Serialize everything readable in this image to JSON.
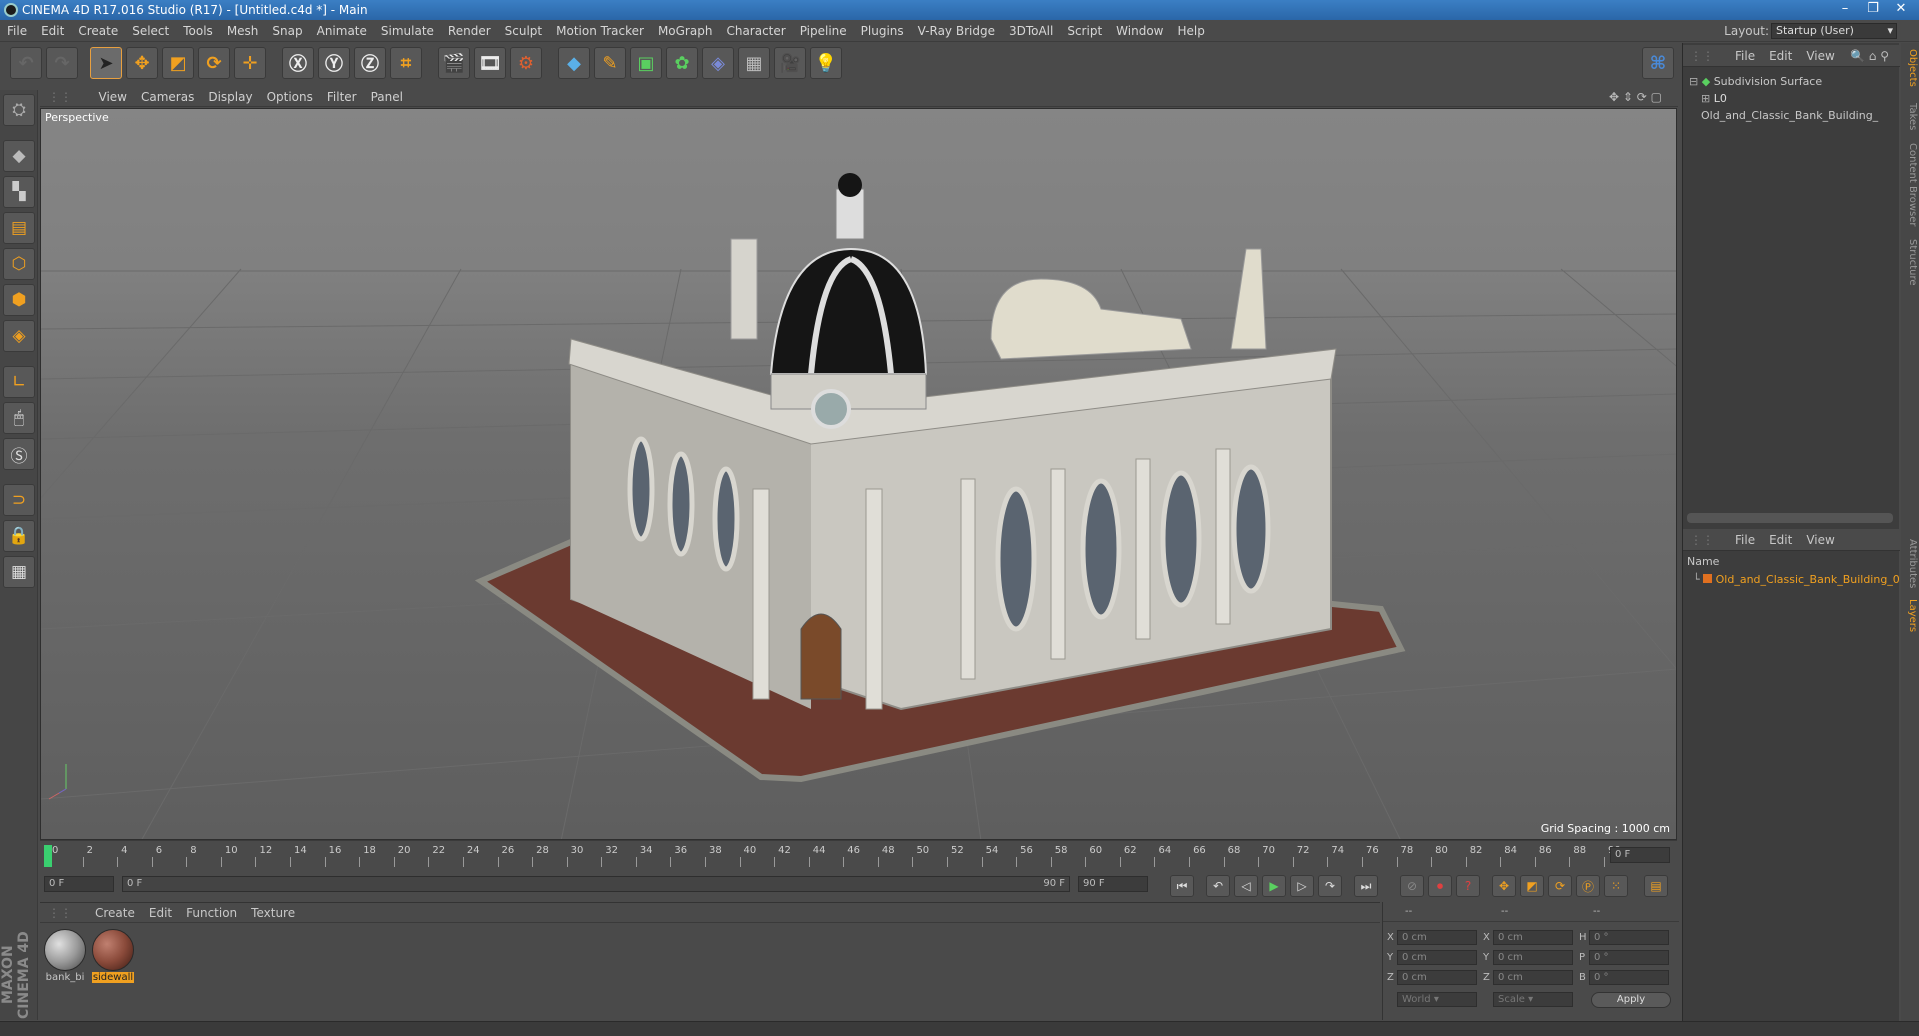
{
  "titlebar": {
    "title": "CINEMA 4D R17.016 Studio (R17) - [Untitled.c4d *] - Main"
  },
  "menubar": {
    "items": [
      "File",
      "Edit",
      "Create",
      "Select",
      "Tools",
      "Mesh",
      "Snap",
      "Animate",
      "Simulate",
      "Render",
      "Sculpt",
      "Motion Tracker",
      "MoGraph",
      "Character",
      "Pipeline",
      "Plugins",
      "V-Ray Bridge",
      "3DToAll",
      "Script",
      "Window",
      "Help"
    ],
    "layout_label": "Layout:",
    "layout_value": "Startup (User)"
  },
  "viewport": {
    "menu": [
      "View",
      "Cameras",
      "Display",
      "Options",
      "Filter",
      "Panel"
    ],
    "camera_label": "Perspective",
    "grid_spacing": "Grid Spacing : 1000 cm"
  },
  "timeline": {
    "ticks": [
      "0",
      "2",
      "4",
      "6",
      "8",
      "10",
      "12",
      "14",
      "16",
      "18",
      "20",
      "22",
      "24",
      "26",
      "28",
      "30",
      "32",
      "34",
      "36",
      "38",
      "40",
      "42",
      "44",
      "46",
      "48",
      "50",
      "52",
      "54",
      "56",
      "58",
      "60",
      "62",
      "64",
      "66",
      "68",
      "70",
      "72",
      "74",
      "76",
      "78",
      "80",
      "82",
      "84",
      "86",
      "88",
      "90"
    ],
    "current_frame": "0 F"
  },
  "transport": {
    "start": "0 F",
    "slider_start": "0 F",
    "slider_end": "90 F",
    "end": "90 F"
  },
  "materials": {
    "menu": [
      "Create",
      "Edit",
      "Function",
      "Texture"
    ],
    "items": [
      {
        "label": "bank_bi",
        "color": "#9a9a9a",
        "selected": false
      },
      {
        "label": "sidewall",
        "color": "#8a4a3a",
        "selected": true
      }
    ]
  },
  "coords": {
    "header": [
      "--",
      "--",
      "--"
    ],
    "rows": [
      {
        "a": "X",
        "v1": "0 cm",
        "b": "X",
        "v2": "0 cm",
        "c": "H",
        "v3": "0 °"
      },
      {
        "a": "Y",
        "v1": "0 cm",
        "b": "Y",
        "v2": "0 cm",
        "c": "P",
        "v3": "0 °"
      },
      {
        "a": "Z",
        "v1": "0 cm",
        "b": "Z",
        "v2": "0 cm",
        "c": "B",
        "v3": "0 °"
      }
    ],
    "mode": "World",
    "scale": "Scale",
    "apply": "Apply"
  },
  "objects_panel": {
    "menu": [
      "File",
      "Edit",
      "View"
    ],
    "tree": [
      {
        "name": "Subdivision Surface",
        "icon": "subdivision-icon"
      },
      {
        "name": "Old_and_Classic_Bank_Building_",
        "icon": "layer-object-icon"
      }
    ]
  },
  "layers_panel": {
    "menu": [
      "File",
      "Edit",
      "View"
    ],
    "column": "Name",
    "items": [
      {
        "name": "Old_and_Classic_Bank_Building_0",
        "color": "#e07020"
      }
    ]
  },
  "right_tabs": [
    "Objects",
    "Takes",
    "Content Browser",
    "Structure",
    "Attributes",
    "Layers"
  ],
  "logo": "MAXON CINEMA 4D",
  "colors": {
    "accent": "#e8a040",
    "selection": "#f0a020",
    "title_blue": "#2a66a8"
  }
}
